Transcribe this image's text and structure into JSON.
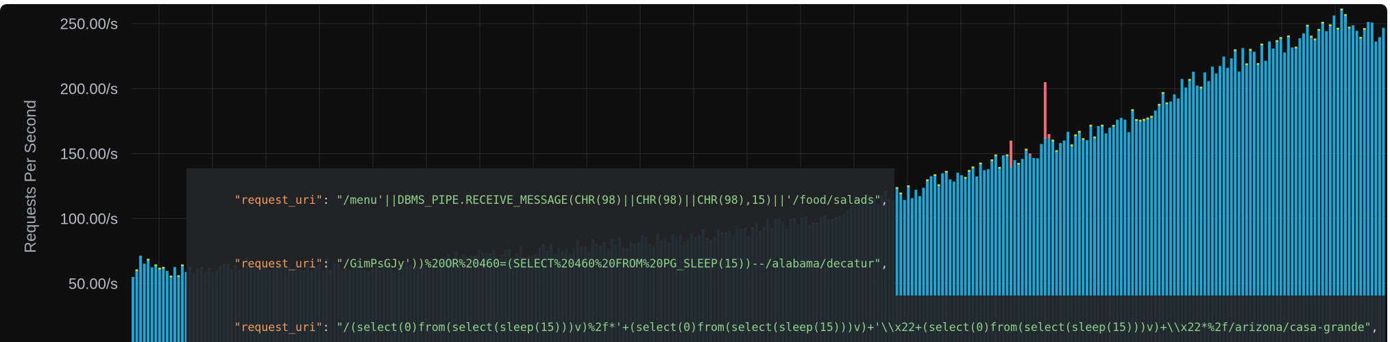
{
  "chart_data": {
    "type": "bar",
    "title": "",
    "xlabel": "",
    "ylabel": "Requests Per Second",
    "ylim": [
      30,
      265
    ],
    "yticks": [
      {
        "value": 50,
        "label": "50.00/s"
      },
      {
        "value": 100,
        "label": "100.00/s"
      },
      {
        "value": 150,
        "label": "150.00/s"
      },
      {
        "value": 200,
        "label": "200.00/s"
      },
      {
        "value": 250,
        "label": "250.00/s"
      }
    ],
    "grid": true,
    "colors": {
      "normal": "#1ea6d6",
      "attack": "#ef6a73",
      "top_accent": "#c4d94a",
      "background": "#0f0f10",
      "grid": "#2a2b2e"
    },
    "bar_count": 330,
    "trend_keypoints": [
      [
        0,
        55
      ],
      [
        2,
        72
      ],
      [
        6,
        62
      ],
      [
        10,
        58
      ],
      [
        20,
        62
      ],
      [
        30,
        64
      ],
      [
        40,
        63
      ],
      [
        50,
        64
      ],
      [
        65,
        62
      ],
      [
        80,
        68
      ],
      [
        95,
        72
      ],
      [
        110,
        76
      ],
      [
        125,
        80
      ],
      [
        140,
        84
      ],
      [
        155,
        88
      ],
      [
        165,
        94
      ],
      [
        175,
        98
      ],
      [
        185,
        104
      ],
      [
        190,
        112
      ],
      [
        198,
        118
      ],
      [
        205,
        122
      ],
      [
        212,
        128
      ],
      [
        220,
        138
      ],
      [
        228,
        144
      ],
      [
        236,
        152
      ],
      [
        244,
        158
      ],
      [
        252,
        164
      ],
      [
        260,
        172
      ],
      [
        266,
        178
      ],
      [
        272,
        196
      ],
      [
        278,
        204
      ],
      [
        286,
        216
      ],
      [
        294,
        224
      ],
      [
        302,
        234
      ],
      [
        310,
        244
      ],
      [
        316,
        253
      ],
      [
        322,
        246
      ],
      [
        329,
        244
      ]
    ],
    "attack_spikes": [
      {
        "index": 231,
        "value": 160
      },
      {
        "index": 236,
        "value": 150
      },
      {
        "index": 240,
        "value": 205
      },
      {
        "index": 241,
        "value": 165
      },
      {
        "index": 242,
        "value": 158
      }
    ]
  },
  "log_overlay": {
    "lines": [
      {
        "key": "\"request_uri\"",
        "sep": ": ",
        "value": "\"/menu'||DBMS_PIPE.RECEIVE_MESSAGE(CHR(98)||CHR(98)||CHR(98),15)||'/food/salads\"",
        "end": ","
      },
      {
        "key": "\"request_uri\"",
        "sep": ": ",
        "value": "\"/GimPsGJy'))%20OR%20460=(SELECT%20460%20FROM%20PG_SLEEP(15))--/alabama/decatur\"",
        "end": ","
      },
      {
        "key": "\"request_uri\"",
        "sep": ": ",
        "value": "\"/(select(0)from(select(sleep(15)))v)%2f*'+(select(0)from(select(sleep(15)))v)+'\\\\x22+(select(0)from(select(sleep(15)))v)+\\\\x22*%2f/arizona/casa-grande\"",
        "end": ","
      }
    ]
  }
}
